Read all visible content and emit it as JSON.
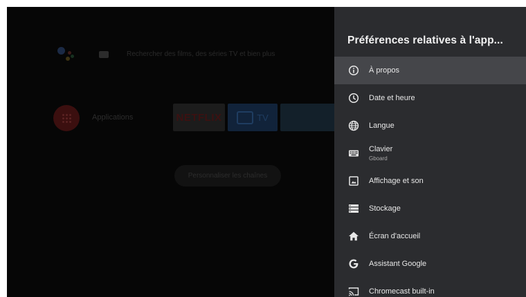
{
  "home": {
    "search_hint": "Rechercher des films, des séries TV et bien plus",
    "apps_label": "Applications",
    "netflix_label": "NETFLIX",
    "tv_label": "TV",
    "customize_label": "Personnaliser les chaînes"
  },
  "panel": {
    "title": "Préférences relatives à l'app...",
    "items": [
      {
        "label": "À propos",
        "icon": "info-icon",
        "selected": true
      },
      {
        "label": "Date et heure",
        "icon": "clock-icon"
      },
      {
        "label": "Langue",
        "icon": "globe-icon"
      },
      {
        "label": "Clavier",
        "sublabel": "Gboard",
        "icon": "keyboard-icon"
      },
      {
        "label": "Affichage et son",
        "icon": "display-icon"
      },
      {
        "label": "Stockage",
        "icon": "storage-icon"
      },
      {
        "label": "Écran d'accueil",
        "icon": "home-icon"
      },
      {
        "label": "Assistant Google",
        "icon": "google-icon"
      },
      {
        "label": "Chromecast built-in",
        "icon": "cast-icon"
      }
    ]
  },
  "colors": {
    "panel_bg": "#2b2c2f",
    "selected_bg": "#45464a",
    "screen_bg": "#060606"
  }
}
